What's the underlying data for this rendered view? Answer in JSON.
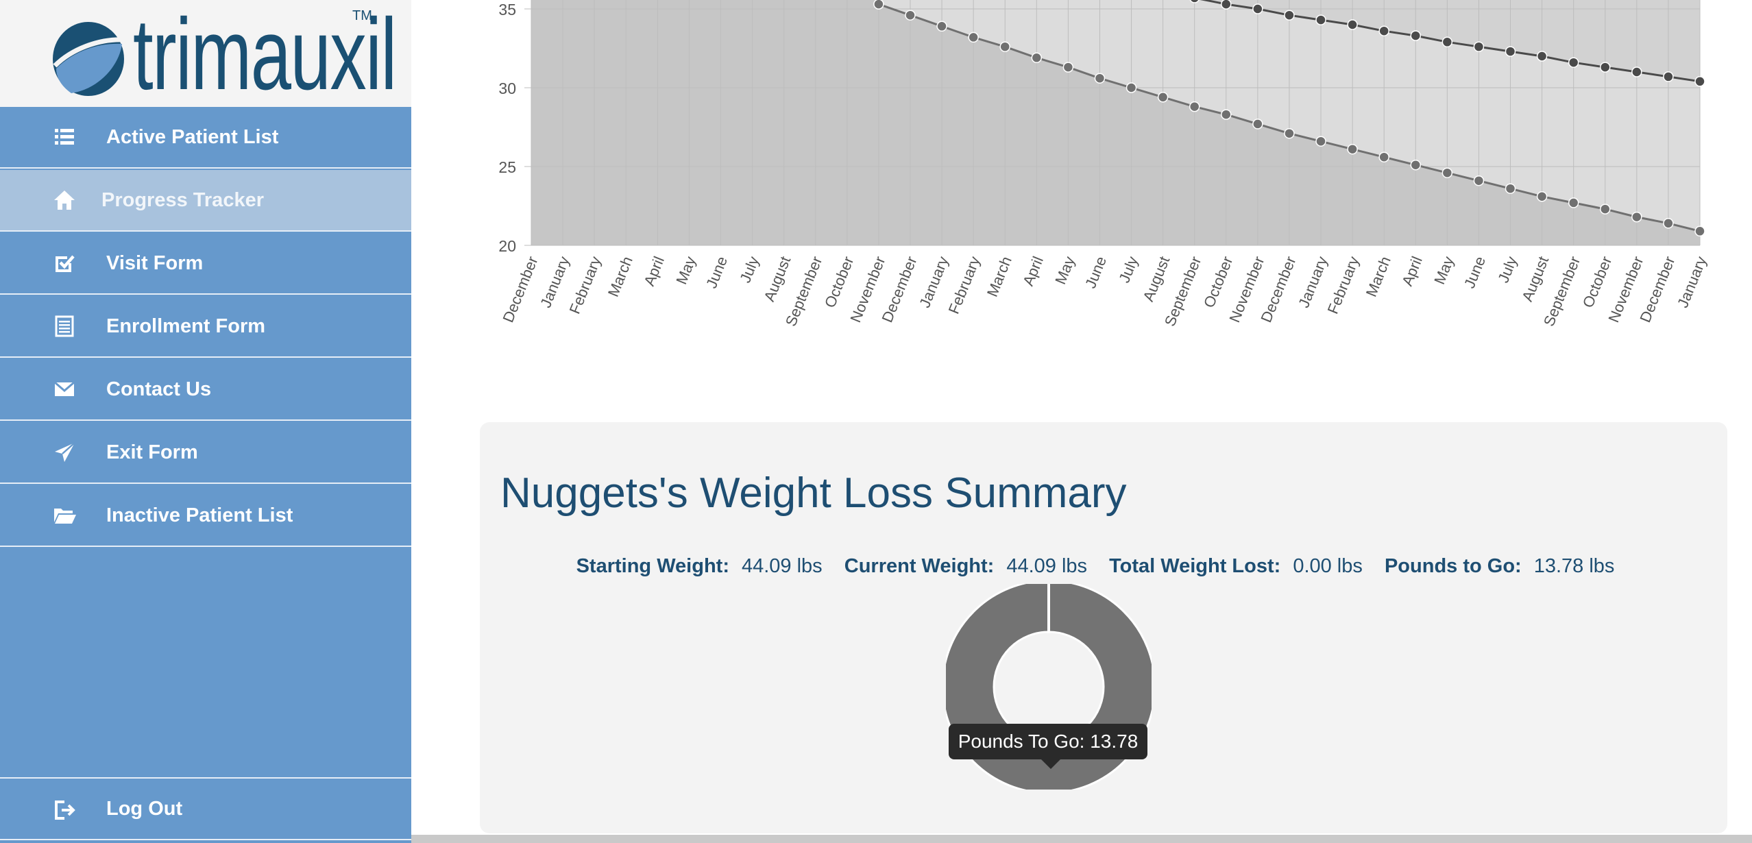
{
  "brand": {
    "name": "trimauxil",
    "trademark": "TM"
  },
  "sidebar": {
    "items": [
      {
        "label": "Active Patient List",
        "icon": "list-icon",
        "active": false
      },
      {
        "label": "Progress Tracker",
        "icon": "home-icon",
        "active": true
      },
      {
        "label": "Visit Form",
        "icon": "check-square-icon",
        "active": false
      },
      {
        "label": "Enrollment Form",
        "icon": "form-icon",
        "active": false
      },
      {
        "label": "Contact Us",
        "icon": "envelope-icon",
        "active": false
      },
      {
        "label": "Exit Form",
        "icon": "send-icon",
        "active": false
      },
      {
        "label": "Inactive Patient List",
        "icon": "folder-open-icon",
        "active": false
      }
    ],
    "logout": {
      "label": "Log Out",
      "icon": "sign-out-icon"
    }
  },
  "chart_data": {
    "type": "area",
    "x": [
      "December",
      "January",
      "February",
      "March",
      "April",
      "May",
      "June",
      "July",
      "August",
      "September",
      "October",
      "November",
      "December",
      "January",
      "February",
      "March",
      "April",
      "May",
      "June",
      "July",
      "August",
      "September",
      "October",
      "November",
      "December",
      "January",
      "February",
      "March",
      "April",
      "May",
      "June",
      "July",
      "August",
      "September",
      "October",
      "November",
      "December",
      "January"
    ],
    "y_ticks": [
      "35",
      "30",
      "25",
      "20"
    ],
    "ylim": [
      20,
      35
    ],
    "series": [
      {
        "values": [
          null,
          null,
          null,
          null,
          null,
          null,
          null,
          null,
          null,
          null,
          null,
          null,
          null,
          null,
          null,
          null,
          null,
          null,
          null,
          null,
          null,
          35.7,
          35.3,
          35.0,
          34.6,
          34.3,
          34.0,
          33.6,
          33.3,
          32.9,
          32.6,
          32.3,
          32.0,
          31.6,
          31.3,
          31.0,
          30.7,
          30.4
        ],
        "color": "#4a4a4a",
        "fill": "#dcdcdc"
      },
      {
        "values": [
          null,
          null,
          null,
          null,
          null,
          null,
          null,
          null,
          null,
          null,
          null,
          35.3,
          34.6,
          33.9,
          33.2,
          32.6,
          31.9,
          31.3,
          30.6,
          30.0,
          29.4,
          28.8,
          28.3,
          27.7,
          27.1,
          26.6,
          26.1,
          25.6,
          25.1,
          24.6,
          24.1,
          23.6,
          23.1,
          22.7,
          22.3,
          21.8,
          21.4,
          20.9
        ],
        "color": "#707070",
        "fill": "#c6c6c6"
      }
    ],
    "grid": true
  },
  "summary": {
    "title": "Nuggets's Weight Loss Summary",
    "stats": [
      {
        "label": "Starting Weight:",
        "value": "44.09 lbs"
      },
      {
        "label": "Current Weight:",
        "value": "44.09 lbs"
      },
      {
        "label": "Total Weight Lost:",
        "value": "0.00 lbs"
      },
      {
        "label": "Pounds to Go:",
        "value": "13.78 lbs"
      }
    ],
    "donut": {
      "type": "pie",
      "slices": [
        {
          "label": "Pounds To Go",
          "value": 13.78,
          "color": "#737373"
        }
      ]
    },
    "tooltip": "Pounds To Go: 13.78"
  }
}
